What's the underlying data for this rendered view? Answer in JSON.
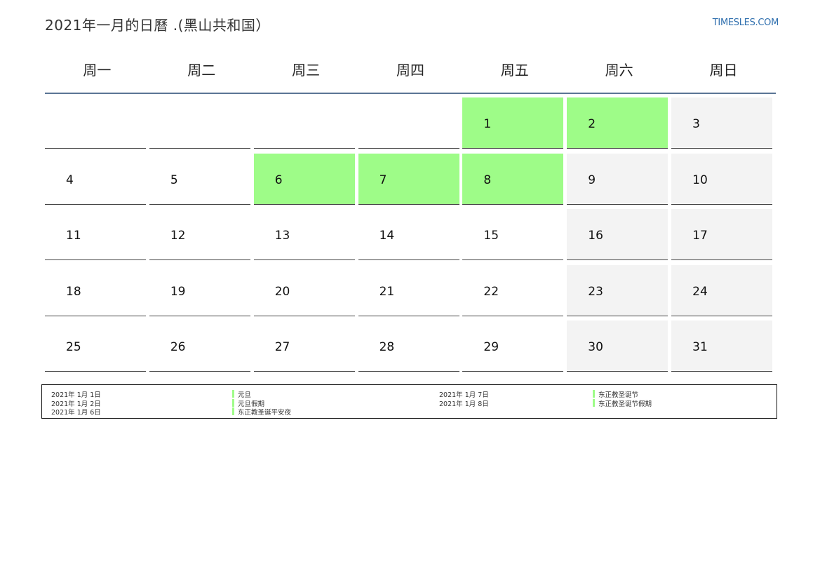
{
  "title": "2021年一月的日曆 .(黑山共和国）",
  "brand": "TIMESLES.COM",
  "colors": {
    "holiday": "#9efc88",
    "weekend": "#f3f3f3",
    "rule": "#5a7595",
    "brand": "#2f6fae"
  },
  "weekdays": [
    "周一",
    "周二",
    "周三",
    "周四",
    "周五",
    "周六",
    "周日"
  ],
  "weeks": [
    [
      {
        "day": "",
        "type": "blank"
      },
      {
        "day": "",
        "type": "blank"
      },
      {
        "day": "",
        "type": "blank"
      },
      {
        "day": "",
        "type": "blank"
      },
      {
        "day": "1",
        "type": "holiday"
      },
      {
        "day": "2",
        "type": "holiday"
      },
      {
        "day": "3",
        "type": "weekend"
      }
    ],
    [
      {
        "day": "4",
        "type": "normal"
      },
      {
        "day": "5",
        "type": "normal"
      },
      {
        "day": "6",
        "type": "holiday"
      },
      {
        "day": "7",
        "type": "holiday"
      },
      {
        "day": "8",
        "type": "holiday"
      },
      {
        "day": "9",
        "type": "weekend"
      },
      {
        "day": "10",
        "type": "weekend"
      }
    ],
    [
      {
        "day": "11",
        "type": "normal"
      },
      {
        "day": "12",
        "type": "normal"
      },
      {
        "day": "13",
        "type": "normal"
      },
      {
        "day": "14",
        "type": "normal"
      },
      {
        "day": "15",
        "type": "normal"
      },
      {
        "day": "16",
        "type": "weekend"
      },
      {
        "day": "17",
        "type": "weekend"
      }
    ],
    [
      {
        "day": "18",
        "type": "normal"
      },
      {
        "day": "19",
        "type": "normal"
      },
      {
        "day": "20",
        "type": "normal"
      },
      {
        "day": "21",
        "type": "normal"
      },
      {
        "day": "22",
        "type": "normal"
      },
      {
        "day": "23",
        "type": "weekend"
      },
      {
        "day": "24",
        "type": "weekend"
      }
    ],
    [
      {
        "day": "25",
        "type": "normal"
      },
      {
        "day": "26",
        "type": "normal"
      },
      {
        "day": "27",
        "type": "normal"
      },
      {
        "day": "28",
        "type": "normal"
      },
      {
        "day": "29",
        "type": "normal"
      },
      {
        "day": "30",
        "type": "weekend"
      },
      {
        "day": "31",
        "type": "weekend"
      }
    ]
  ],
  "holidays": [
    {
      "date": "2021年 1月 1日",
      "name": "元旦"
    },
    {
      "date": "2021年 1月 2日",
      "name": "元旦假期"
    },
    {
      "date": "2021年 1月 6日",
      "name": "东正教圣诞平安夜"
    },
    {
      "date": "2021年 1月 7日",
      "name": "东正教圣诞节"
    },
    {
      "date": "2021年 1月 8日",
      "name": "东正教圣诞节假期"
    }
  ]
}
